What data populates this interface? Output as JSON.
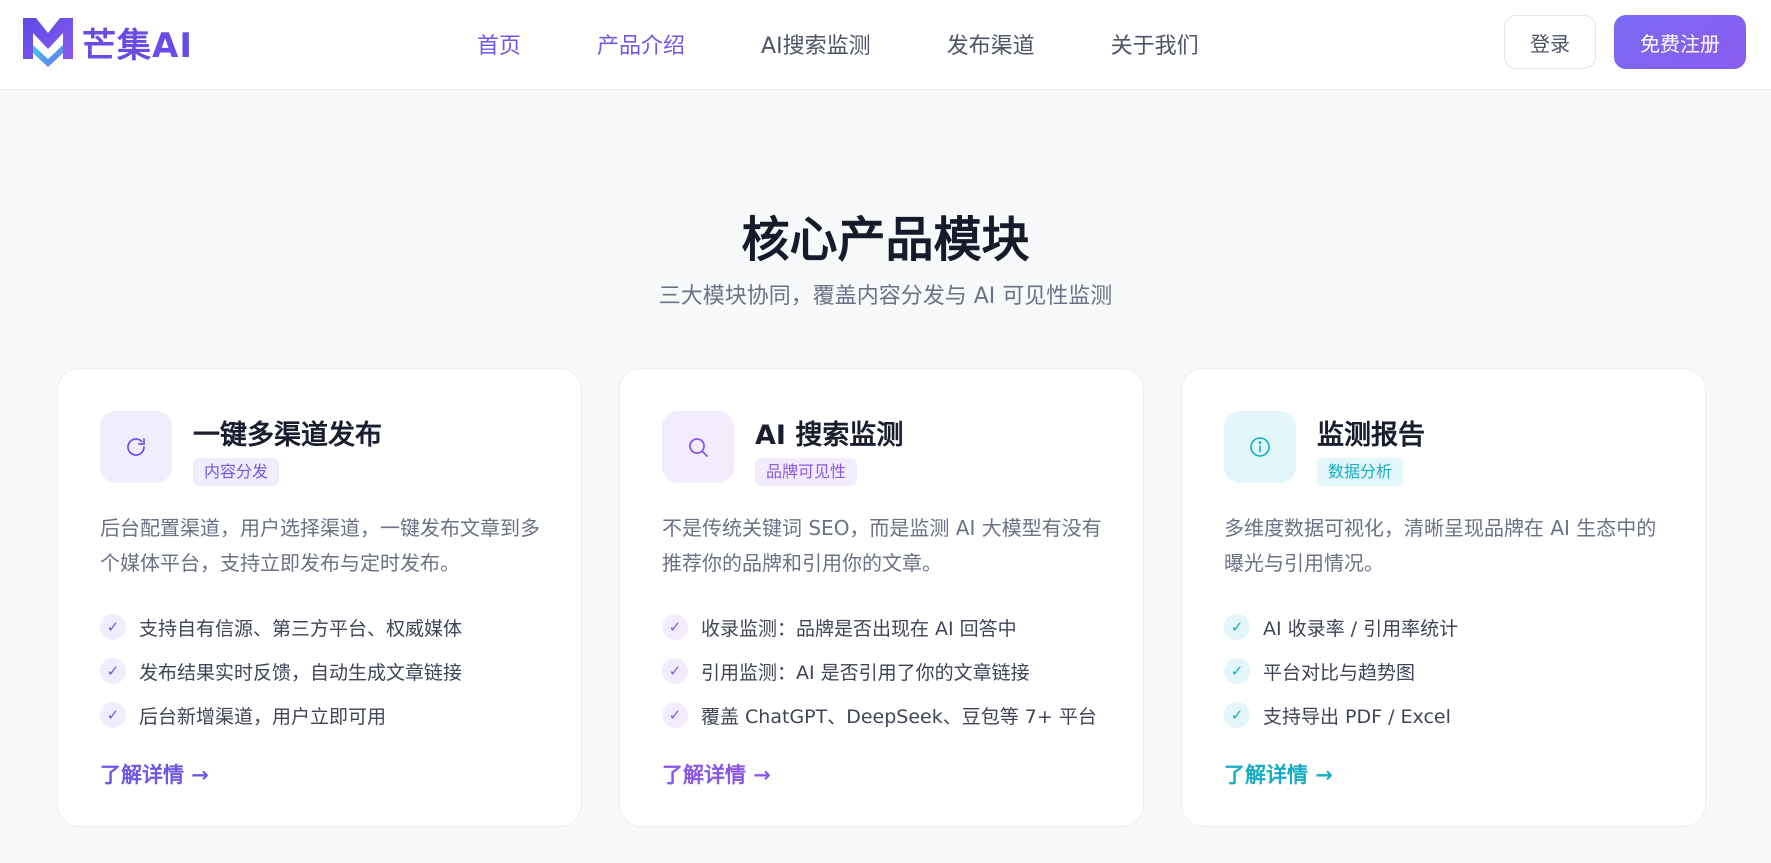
{
  "header": {
    "logo_text": "芒集AI",
    "nav": [
      {
        "label": "首页",
        "active": true
      },
      {
        "label": "产品介绍",
        "active": true
      },
      {
        "label": "AI搜索监测",
        "active": false
      },
      {
        "label": "发布渠道",
        "active": false
      },
      {
        "label": "关于我们",
        "active": false
      }
    ],
    "login_label": "登录",
    "register_label": "免费注册"
  },
  "section": {
    "title": "核心产品模块",
    "subtitle": "三大模块协同，覆盖内容分发与 AI 可见性监测"
  },
  "cards": [
    {
      "icon": "refresh-icon",
      "title": "一键多渠道发布",
      "tag": "内容分发",
      "description": "后台配置渠道，用户选择渠道，一键发布文章到多个媒体平台，支持立即发布与定时发布。",
      "features": [
        "支持自有信源、第三方平台、权威媒体",
        "发布结果实时反馈，自动生成文章链接",
        "后台新增渠道，用户立即可用"
      ],
      "link": "了解详情 →",
      "accent": "#6c59e6"
    },
    {
      "icon": "search-icon",
      "title": "AI 搜索监测",
      "tag": "品牌可见性",
      "description": "不是传统关键词 SEO，而是监测 AI 大模型有没有推荐你的品牌和引用你的文章。",
      "features": [
        "收录监测：品牌是否出现在 AI 回答中",
        "引用监测：AI 是否引用了你的文章链接",
        "覆盖 ChatGPT、DeepSeek、豆包等 7+ 平台"
      ],
      "link": "了解详情 →",
      "accent": "#8b57e8"
    },
    {
      "icon": "info-icon",
      "title": "监测报告",
      "tag": "数据分析",
      "description": "多维度数据可视化，清晰呈现品牌在 AI 生态中的曝光与引用情况。",
      "features": [
        "AI 收录率 / 引用率统计",
        "平台对比与趋势图",
        "支持导出 PDF / Excel"
      ],
      "link": "了解详情 →",
      "accent": "#16adc4"
    }
  ],
  "check_glyph": "✓"
}
